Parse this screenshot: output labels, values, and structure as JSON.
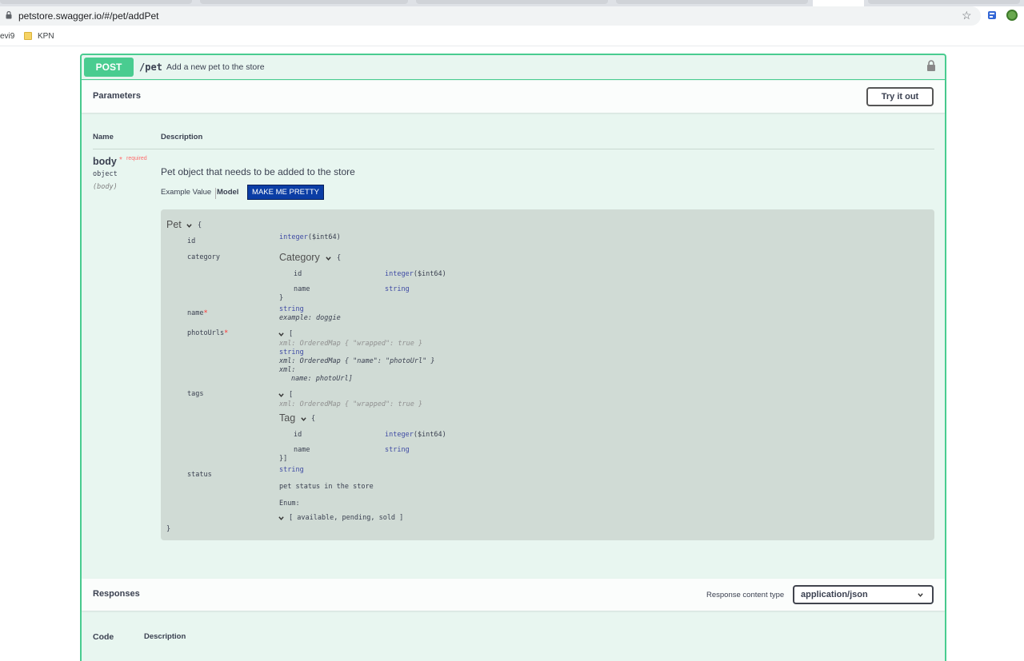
{
  "browser": {
    "url": "petstore.swagger.io/#/pet/addPet",
    "bookmarks": [
      "evi9",
      "KPN"
    ]
  },
  "operation": {
    "method": "POST",
    "path": "/pet",
    "summary": "Add a new pet to the store"
  },
  "parameters": {
    "title": "Parameters",
    "try_label": "Try it out",
    "col_name": "Name",
    "col_description": "Description",
    "param_name": "body",
    "required_star": "*",
    "required_label": "required",
    "param_type": "object",
    "param_in": "(body)",
    "param_description": "Pet object that needs to be added to the store",
    "tab_example": "Example Value",
    "tab_model": "Model",
    "pretty_button": "MAKE ME PRETTY"
  },
  "model": {
    "title": "Pet",
    "open_brace": "{",
    "close_brace": "}",
    "id_label": "id",
    "id_type": "integer",
    "id_format": "($int64)",
    "category_label": "category",
    "category_title": "Category",
    "category_id_label": "id",
    "category_id_type": "integer",
    "category_id_format": "($int64)",
    "category_name_label": "name",
    "category_name_type": "string",
    "category_close": "}",
    "name_label": "name",
    "name_star": "*",
    "name_type": "string",
    "name_example": "example: doggie",
    "photo_label": "photoUrls",
    "photo_star": "*",
    "photo_open": "[",
    "photo_xml_wrapped": "xml: OrderedMap { \"wrapped\": true }",
    "photo_type": "string",
    "photo_xml_name": "xml: OrderedMap { \"name\": \"photoUrl\" }",
    "photo_xml": "xml:",
    "photo_xml_name2": "name: photoUrl]",
    "tags_label": "tags",
    "tags_open": "[",
    "tags_xml_wrapped": "xml: OrderedMap { \"wrapped\": true }",
    "tag_title": "Tag",
    "tag_id_label": "id",
    "tag_id_type": "integer",
    "tag_id_format": "($int64)",
    "tag_name_label": "name",
    "tag_name_type": "string",
    "tags_close": "}]",
    "status_label": "status",
    "status_type": "string",
    "status_desc": "pet status in the store",
    "status_enum_label": "Enum:",
    "status_enum_values": "[ available, pending, sold ]"
  },
  "responses": {
    "title": "Responses",
    "content_type_label": "Response content type",
    "content_type_value": "application/json",
    "col_code": "Code",
    "col_description": "Description"
  }
}
